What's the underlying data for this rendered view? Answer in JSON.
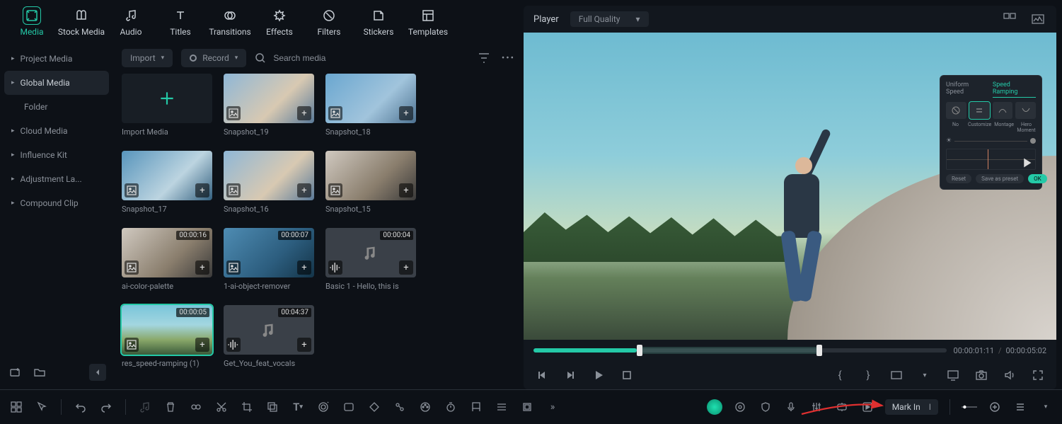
{
  "top_tabs": [
    {
      "label": "Media",
      "active": true
    },
    {
      "label": "Stock Media"
    },
    {
      "label": "Audio"
    },
    {
      "label": "Titles"
    },
    {
      "label": "Transitions"
    },
    {
      "label": "Effects"
    },
    {
      "label": "Filters"
    },
    {
      "label": "Stickers"
    },
    {
      "label": "Templates"
    }
  ],
  "sidebar": [
    {
      "label": "Project Media",
      "caret": true
    },
    {
      "label": "Global Media",
      "caret": true,
      "active": true
    },
    {
      "label": "Folder",
      "sub": true
    },
    {
      "label": "Cloud Media",
      "caret": true
    },
    {
      "label": "Influence Kit",
      "caret": true
    },
    {
      "label": "Adjustment La...",
      "caret": true
    },
    {
      "label": "Compound Clip",
      "caret": true
    }
  ],
  "media_toolbar": {
    "import_label": "Import",
    "record_label": "Record",
    "search_placeholder": "Search media"
  },
  "tiles": [
    {
      "caption": "Import Media",
      "kind": "import"
    },
    {
      "caption": "Snapshot_19",
      "thumb": "g1"
    },
    {
      "caption": "Snapshot_18",
      "thumb": "g2"
    },
    {
      "caption": "Snapshot_17",
      "thumb": "g3"
    },
    {
      "caption": "Snapshot_16",
      "thumb": "g1"
    },
    {
      "caption": "Snapshot_15",
      "thumb": "g4"
    },
    {
      "caption": "ai-color-palette",
      "thumb": "g4",
      "dur": "00:00:16"
    },
    {
      "caption": "1-ai-object-remover",
      "thumb": "g5",
      "dur": "00:00:07"
    },
    {
      "caption": "Basic 1 - Hello, this is",
      "kind": "audio",
      "dur": "00:00:04"
    },
    {
      "caption": "res_speed-ramping (1)",
      "thumb": "g7",
      "dur": "00:00:05",
      "selected": true
    },
    {
      "caption": "Get_You_feat_vocals",
      "kind": "audio",
      "dur": "00:04:37"
    }
  ],
  "player": {
    "label": "Player",
    "quality": "Full Quality",
    "time_current": "00:00:01:11",
    "time_total": "00:00:05:02"
  },
  "ramp_panel": {
    "tab1": "Uniform Speed",
    "tab2": "Speed Ramping",
    "presets": [
      "No",
      "Customize",
      "Montage",
      "Hero Moment"
    ],
    "reset": "Reset",
    "save": "Save as preset",
    "ok": "OK"
  },
  "tooltip": {
    "label": "Mark In",
    "key": "I"
  }
}
